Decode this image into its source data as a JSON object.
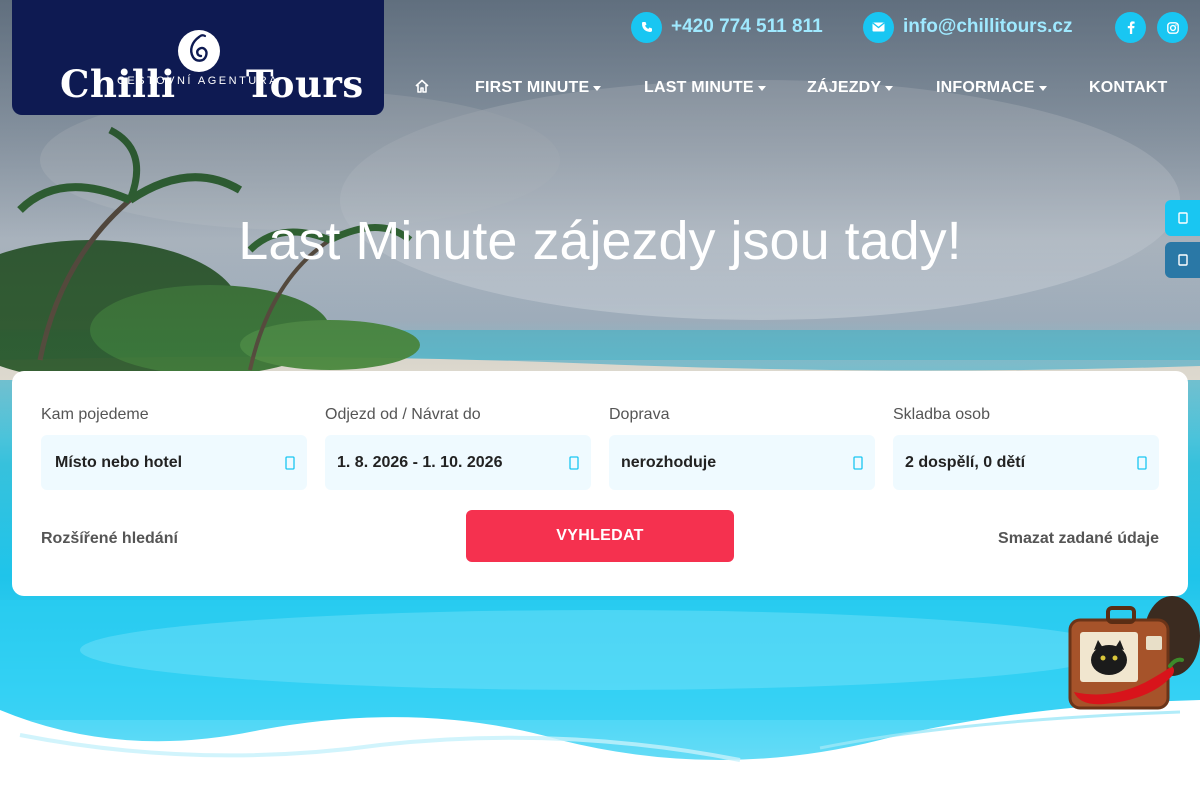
{
  "brand": {
    "name_part1": "Chilli",
    "name_part2": "Tours",
    "tagline": "CESTOVNÍ AGENTURA"
  },
  "contact": {
    "phone": "+420 774 511 811",
    "email": "info@chillitours.cz",
    "phone_icon": "phone-icon",
    "email_icon": "envelope-icon"
  },
  "social": {
    "items": [
      {
        "name": "facebook-icon"
      },
      {
        "name": "instagram-icon"
      }
    ]
  },
  "nav": {
    "home_icon": "home-icon",
    "items": [
      {
        "label": "FIRST MINUTE",
        "dropdown": true
      },
      {
        "label": "LAST MINUTE",
        "dropdown": true
      },
      {
        "label": "ZÁJEZDY",
        "dropdown": true
      },
      {
        "label": "INFORMACE",
        "dropdown": true
      },
      {
        "label": "KONTAKT",
        "dropdown": false
      }
    ]
  },
  "hero": {
    "headline": "Last Minute zájezdy jsou tady!"
  },
  "side_tabs": [
    {
      "icon": "side-tab-icon-light"
    },
    {
      "icon": "side-tab-icon-dark"
    }
  ],
  "search": {
    "fields": [
      {
        "label": "Kam pojedeme",
        "value": "Místo nebo hotel",
        "icon": "location-pin-icon"
      },
      {
        "label": "Odjezd od / Návrat do",
        "value": "1. 8. 2026 - 1. 10. 2026",
        "icon": "calendar-icon"
      },
      {
        "label": "Doprava",
        "value": "nerozhoduje",
        "icon": "transport-icon"
      },
      {
        "label": "Skladba osob",
        "value": "2 dospělí, 0 dětí",
        "icon": "people-icon"
      }
    ],
    "advanced_label": "Rozšířené hledání",
    "submit_label": "VYHLEDAT",
    "clear_label": "Smazat zadané údaje"
  },
  "colors": {
    "brand_navy": "#0e1a52",
    "accent_cyan": "#19c6f2",
    "cta_red": "#f5314f",
    "field_bg": "#effaff"
  }
}
